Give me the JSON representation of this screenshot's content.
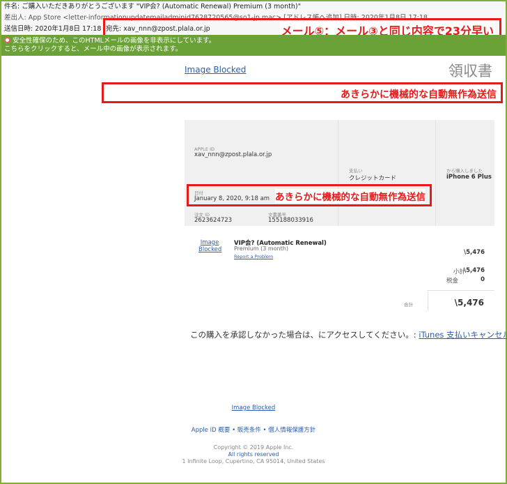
{
  "header": {
    "subject": "件名: ご購入いただきありがとうございます \"VIP会? (Automatic Renewal) Premium (3 month)\"",
    "from": "差出人: App Store <letter-informationupdatemailadminid7628720565@so1-jp.mac> [アドレス帳へ追加]     日時: 2020年1月8日 17:18",
    "sent": "送信日時: 2020年1月8日 17:18",
    "to": "宛先: xav_nnn@zpost.plala.or.jp"
  },
  "warning": {
    "line1": "安全性確保のため、このHTMLメールの画像を非表示にしています。",
    "line2": "こちらをクリックすると、メール中の画像が表示されます。"
  },
  "annotations": {
    "top": "メール⑤：メール③と同じ内容で23分早い",
    "mid": "あきらかに機械的な自動無作為送信",
    "date": "あきらかに機械的な自動無作為送信"
  },
  "receipt": {
    "image_blocked": "Image Blocked",
    "title": "領収書",
    "apple_id_label": "APPLE ID",
    "apple_id": "xav_nnn@zpost.plala.or.jp",
    "payment_label": "支払い",
    "payment": "クレジットカード",
    "purchased_from_label": "から購入しました",
    "device": "iPhone 6 Plus",
    "date_label": "日付",
    "date": "January 8, 2020, 9:18 am",
    "order_id_label": "注文 ID",
    "order_id": "2623624723",
    "doc_no_label": "文書番号",
    "doc_no": "155188033916"
  },
  "item": {
    "image_line1": "Image",
    "image_line2": "Blocked",
    "name": "VIP会? (Automatic Renewal)",
    "sub": "Premium (3 month)",
    "report": "Report a Problem",
    "price": "\\5,476"
  },
  "totals": {
    "subtotal_label": "小計",
    "subtotal": "\\5,476",
    "tax_label": "税金",
    "tax": "0",
    "total_label": "合計",
    "total": "\\5,476"
  },
  "notice": {
    "text": "この購入を承認しなかった場合は、にアクセスしてください。: ",
    "link": "iTunes 支払いキャンセル"
  },
  "footer": {
    "image_blocked": "Image Blocked",
    "links": "Apple ID 概要 • 販売条件 • 個人情報保護方針",
    "copyright": "Copyright © 2019 Apple Inc.",
    "rights": "All rights reserved",
    "address": "1 Infinite Loop, Cupertino, CA 95014, United States"
  }
}
